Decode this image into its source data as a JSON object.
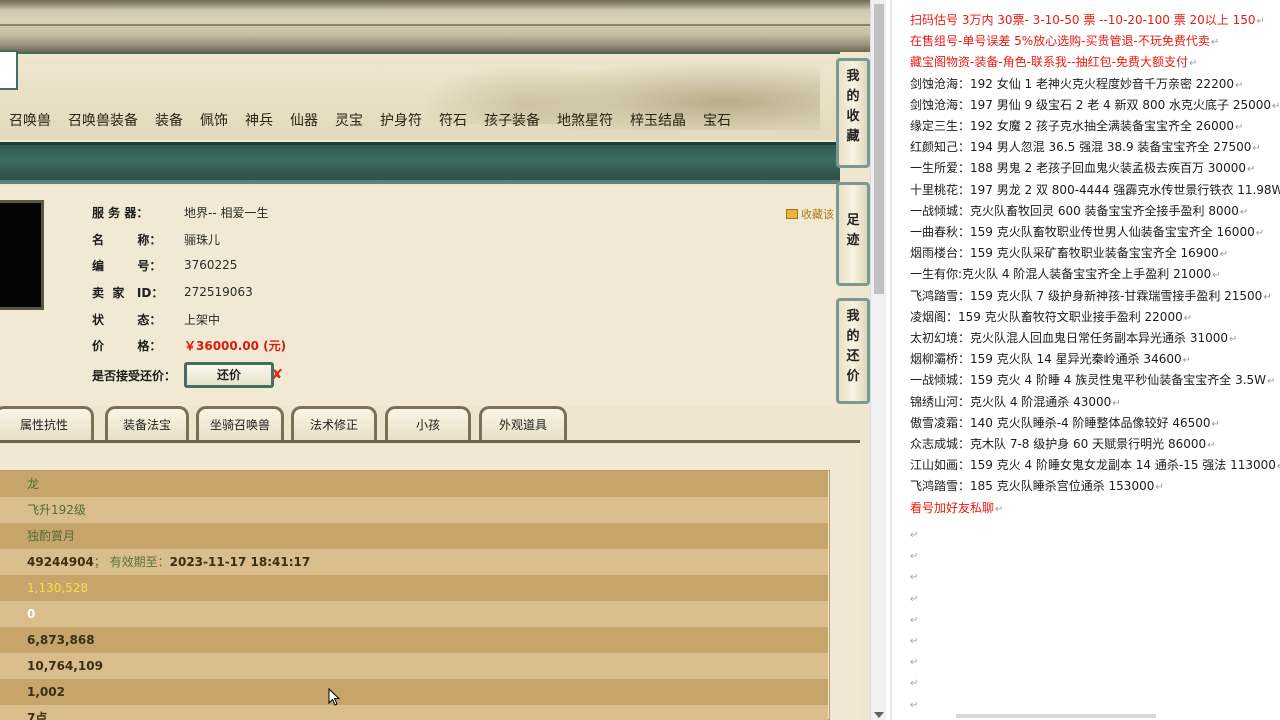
{
  "categories": [
    "召唤兽",
    "召唤兽装备",
    "装备",
    "佩饰",
    "神兵",
    "仙器",
    "灵宝",
    "护身符",
    "符石",
    "孩子装备",
    "地煞星符",
    "梓玉结晶",
    "宝石"
  ],
  "info": {
    "server_label": "服 务 器：",
    "server_value": "地界-- 相爱一生",
    "name_label": "名        称：",
    "name_value": "骊珠儿",
    "id_label": "编        号：",
    "id_value": "3760225",
    "seller_label": "卖  家   ID：",
    "seller_value": "272519063",
    "status_label": "状        态：",
    "status_value": "上架中",
    "price_label": "价        格：",
    "price_value": "￥36000.00 (元)",
    "haggle_label": "是否接受还价：",
    "haggle_button": "还价",
    "favorite": "收藏该"
  },
  "tabs": [
    "属性抗性",
    "装备法宝",
    "坐骑召唤兽",
    "法术修正",
    "小孩",
    "外观道具"
  ],
  "data_rows": [
    {
      "text": "龙",
      "style": "g"
    },
    {
      "text": "飞升192级",
      "style": "g"
    },
    {
      "text": "独酌賞月",
      "style": "g"
    },
    {
      "text": "49244904",
      "label": "；  有效期至：",
      "extra": "2023-11-17 18:41:17",
      "style": "dk"
    },
    {
      "text": "1,130,528",
      "style": "y"
    },
    {
      "text": "0",
      "style": "w"
    },
    {
      "text": "6,873,868",
      "style": "dk"
    },
    {
      "text": "10,764,109",
      "style": "dk"
    },
    {
      "text": "1,002",
      "style": "dk"
    },
    {
      "text": "7点",
      "style": "dk"
    }
  ],
  "side_nav": [
    {
      "label": [
        "我",
        "的",
        "收",
        "藏"
      ]
    },
    {
      "label": [
        "足",
        "迹"
      ]
    },
    {
      "label": [
        "我",
        "的",
        "还",
        "价"
      ]
    }
  ],
  "right_lines": [
    {
      "text": "扫码估号 3万内 30票- 3-10-50 票 --10-20-100 票 20以上 150",
      "red": true
    },
    {
      "text": "在售组号-单号误差 5%放心选购-买贵管退-不玩免费代卖",
      "red": true
    },
    {
      "text": "藏宝阁物资-装备-角色-联系我--抽红包-免费大额支付",
      "red": true
    },
    {
      "text": "剑蚀沧海：192 女仙 1 老神火克火程度妙音千万亲密 22200",
      "red": false
    },
    {
      "text": "剑蚀沧海：197 男仙 9 级宝石 2 老 4 新双 800 水克火底子 25000",
      "red": false
    },
    {
      "text": "缘定三生：192 女魔 2 孩子克水抽全满装备宝宝齐全 26000",
      "red": false
    },
    {
      "text": "红颜知己：194 男人忽混 36.5 强混 38.9 装备宝宝齐全 27500",
      "red": false
    },
    {
      "text": "一生所爱：188 男鬼 2 老孩子回血鬼火装孟极去疾百万 30000",
      "red": false
    },
    {
      "text": "十里桃花：197 男龙 2 双 800-4444 强霹克水传世景行铁衣 11.98W",
      "red": false
    },
    {
      "text": "一战倾城：克火队畜牧回灵 600 装备宝宝齐全接手盈利 8000",
      "red": false
    },
    {
      "text": "一曲春秋：159 克火队畜牧职业传世男人仙装备宝宝齐全 16000",
      "red": false
    },
    {
      "text": "烟雨楼台：159 克火队采矿畜牧职业装备宝宝齐全 16900",
      "red": false
    },
    {
      "text": "一生有你:克火队 4 阶混人装备宝宝齐全上手盈利 21000",
      "red": false
    },
    {
      "text": "飞鸿踏雪：159 克火队 7 级护身新神孩-甘霖瑞雪接手盈利 21500",
      "red": false
    },
    {
      "text": "凌烟阁：159 克火队畜牧符文职业接手盈利 22000",
      "red": false
    },
    {
      "text": "太初幻境：克火队混人回血鬼日常任务副本异光通杀 31000",
      "red": false
    },
    {
      "text": "烟柳灞桥：159 克火队 14 星异光秦岭通杀 34600",
      "red": false
    },
    {
      "text": "一战倾城：159 克火 4 阶睡 4 族灵性鬼平秒仙装备宝宝齐全 3.5W",
      "red": false
    },
    {
      "text": "锦绣山河：克火队 4 阶混通杀 43000",
      "red": false
    },
    {
      "text": "傲雪凌霜：140 克火队睡杀-4 阶睡整体品像较好 46500",
      "red": false
    },
    {
      "text": "众志成城：克木队 7-8 级护身 60 天赋景行明光 86000",
      "red": false
    },
    {
      "text": "江山如画：159 克火 4 阶睡女鬼女龙副本 14 通杀-15 强法 113000",
      "red": false
    },
    {
      "text": "飞鸿踏雪：185 克火队睡杀宫位通杀 153000",
      "red": false
    },
    {
      "text": "看号加好友私聊",
      "red": true
    }
  ],
  "return_mark": "↵"
}
